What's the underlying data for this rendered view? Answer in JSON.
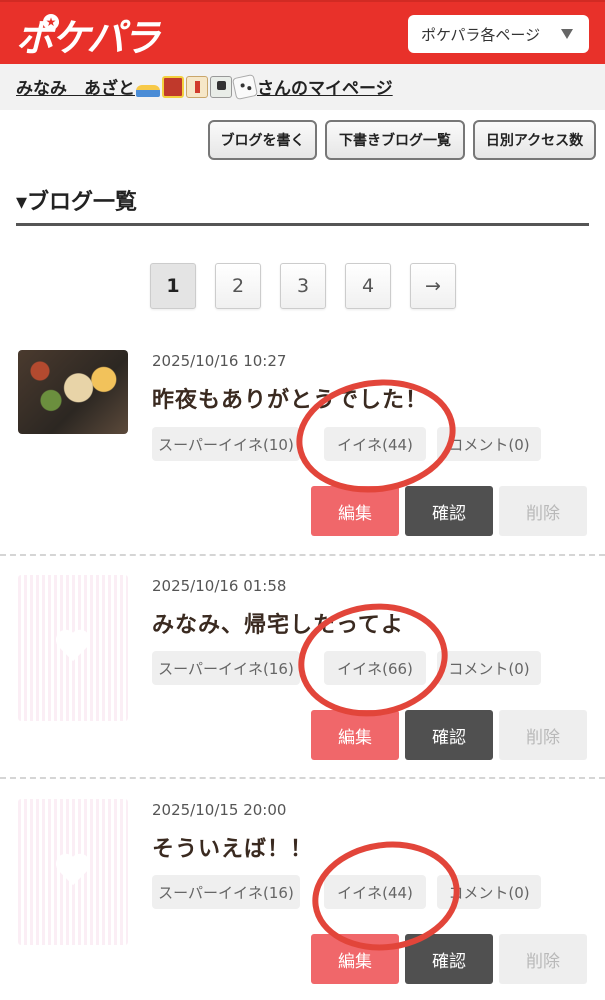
{
  "header": {
    "logo_text": "ポケパラ",
    "page_menu_label": "ポケパラ各ページ"
  },
  "user": {
    "name_prefix": "みなみ　あざと",
    "name_suffix": "さんのマイページ",
    "emoji_icons": [
      "boat-icon",
      "slot-machine-icon",
      "mahjong-chun-icon",
      "mahjong-tile-icon",
      "dice-icon"
    ]
  },
  "toolbar": {
    "write_blog": "ブログを書く",
    "draft_list": "下書きブログ一覧",
    "daily_access": "日別アクセス数"
  },
  "section": {
    "title": "▾ブログ一覧"
  },
  "pagination": {
    "pages": [
      "1",
      "2",
      "3",
      "4"
    ],
    "next": "→",
    "current": "1"
  },
  "posts": [
    {
      "date": "2025/10/16 10:27",
      "title": "昨夜もありがとうでした！",
      "super_iine": "スーパーイイネ(10)",
      "iine": "イイネ(44)",
      "comment": "コメント(0)",
      "thumbnail": "photo",
      "edit": "編集",
      "confirm": "確認",
      "delete": "削除"
    },
    {
      "date": "2025/10/16 01:58",
      "title": "みなみ、帰宅したってよ",
      "super_iine": "スーパーイイネ(16)",
      "iine": "イイネ(66)",
      "comment": "コメント(0)",
      "thumbnail": "heart-placeholder",
      "edit": "編集",
      "confirm": "確認",
      "delete": "削除"
    },
    {
      "date": "2025/10/15 20:00",
      "title": "そういえば！！",
      "super_iine": "スーパーイイネ(16)",
      "iine": "イイネ(44)",
      "comment": "コメント(0)",
      "thumbnail": "heart-placeholder",
      "edit": "編集",
      "confirm": "確認",
      "delete": "削除"
    }
  ],
  "colors": {
    "brand_red": "#e8312a",
    "edit_button": "#f0676a",
    "confirm_button": "#505050",
    "annotation_circle": "#e2453a"
  }
}
